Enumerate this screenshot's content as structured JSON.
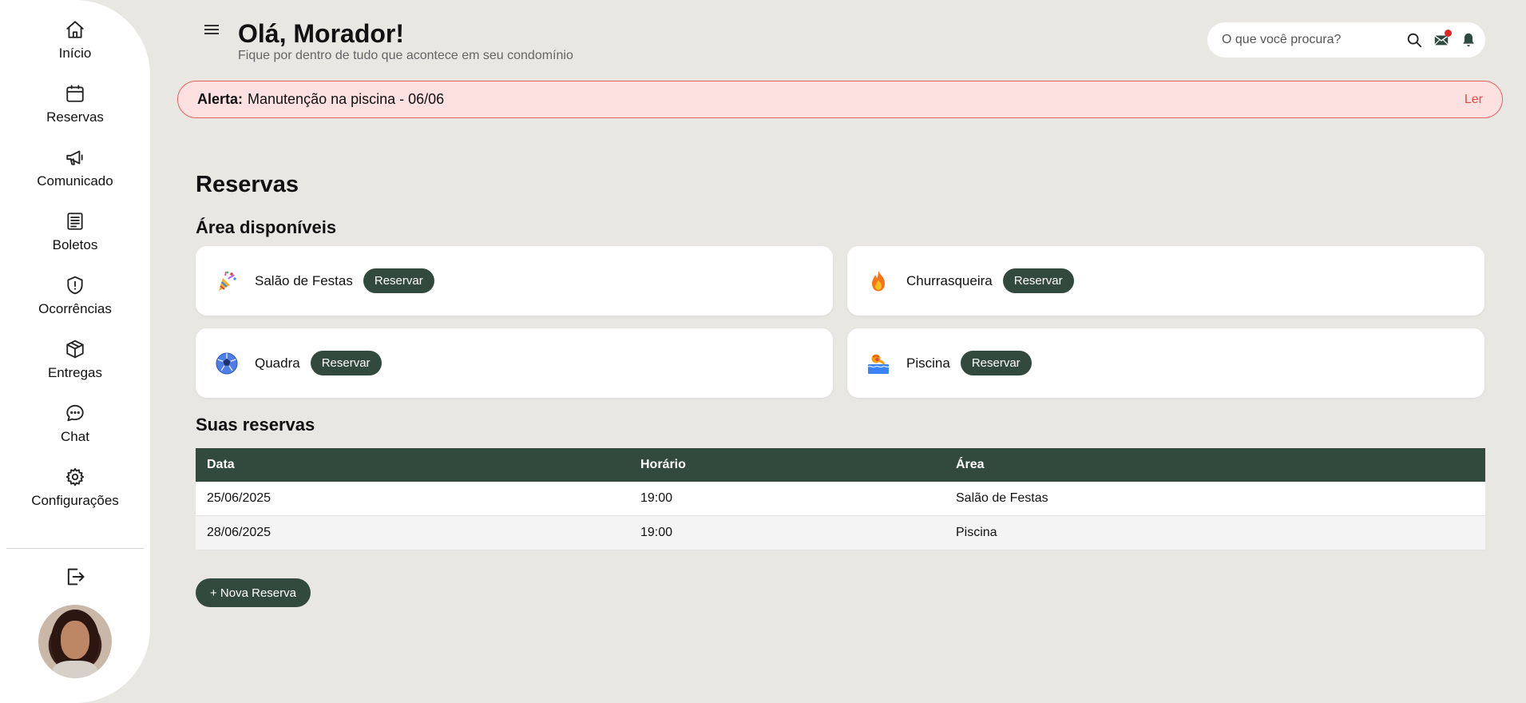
{
  "sidebar": {
    "items": [
      {
        "label": "Início",
        "icon": "home-icon"
      },
      {
        "label": "Reservas",
        "icon": "calendar-icon"
      },
      {
        "label": "Comunicado",
        "icon": "megaphone-icon"
      },
      {
        "label": "Boletos",
        "icon": "invoice-icon"
      },
      {
        "label": "Ocorrências",
        "icon": "shield-alert-icon"
      },
      {
        "label": "Entregas",
        "icon": "package-icon"
      },
      {
        "label": "Chat",
        "icon": "chat-icon"
      },
      {
        "label": "Configurações",
        "icon": "gear-icon"
      }
    ]
  },
  "header": {
    "greeting": "Olá, Morador!",
    "subtitle": "Fique por dentro de tudo que acontece em seu condomínio",
    "search_placeholder": "O que você procura?"
  },
  "alert": {
    "prefix": "Alerta:",
    "message": "Manutenção na piscina - 06/06",
    "action": "Ler"
  },
  "main": {
    "title": "Reservas",
    "areas_title": "Área disponíveis",
    "reserve_label": "Reservar",
    "areas": [
      {
        "name": "Salão de Festas",
        "icon": "party-popper-icon"
      },
      {
        "name": "Churrasqueira",
        "icon": "fire-icon"
      },
      {
        "name": "Quadra",
        "icon": "soccer-ball-icon"
      },
      {
        "name": "Piscina",
        "icon": "pool-icon"
      }
    ],
    "reservations_title": "Suas reservas",
    "table": {
      "headers": [
        "Data",
        "Horário",
        "Área"
      ],
      "rows": [
        [
          "25/06/2025",
          "19:00",
          "Salão de Festas"
        ],
        [
          "28/06/2025",
          "19:00",
          "Piscina"
        ]
      ]
    },
    "new_button": "+ Nova Reserva"
  },
  "colors": {
    "primary": "#324a3d",
    "background": "#e9e7e2",
    "alert_bg": "#fde1e1",
    "alert_border": "#e46262",
    "alert_action": "#e04b4b"
  }
}
